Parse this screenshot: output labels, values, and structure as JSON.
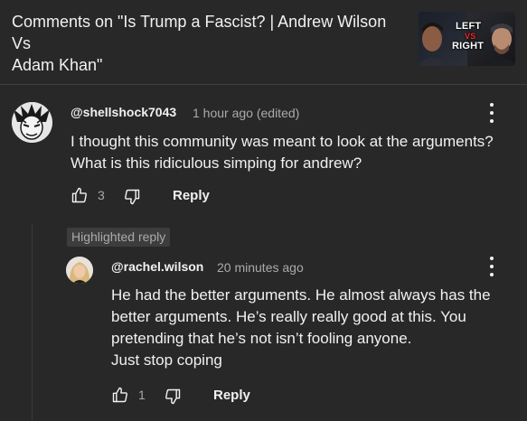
{
  "header": {
    "title_line1": "Comments on \"Is Trump a Fascist? | Andrew Wilson Vs",
    "title_line2": "Adam Khan\"",
    "thumbnail": {
      "label_left": "LEFT",
      "label_vs": "VS",
      "label_right": "RIGHT"
    }
  },
  "comment": {
    "author": "@shellshock7043",
    "time": "1 hour ago (edited)",
    "body": [
      "I thought this community was meant to look at the arguments?",
      "What is this ridiculous simping for andrew?"
    ],
    "like_count": "3",
    "reply_label": "Reply",
    "avatar_icon": "cartoon-face-avatar"
  },
  "highlight_badge": "Highlighted reply",
  "reply": {
    "author": "@rachel.wilson",
    "time": "20 minutes ago",
    "body": [
      "He had the better arguments. He almost always has the",
      "better arguments. He’s really really good at this. You",
      "pretending that he’s not isn’t fooling anyone.",
      "Just stop coping"
    ],
    "like_count": "1",
    "reply_label": "Reply",
    "avatar_icon": "blonde-woman-avatar"
  },
  "colors": {
    "background": "#282828",
    "text_primary": "#f1f1f1",
    "text_secondary": "#aaaaaa",
    "thumb_vs": "#e8302b"
  },
  "icons": [
    "more-vert-icon",
    "thumb-up-icon",
    "thumb-down-icon"
  ]
}
